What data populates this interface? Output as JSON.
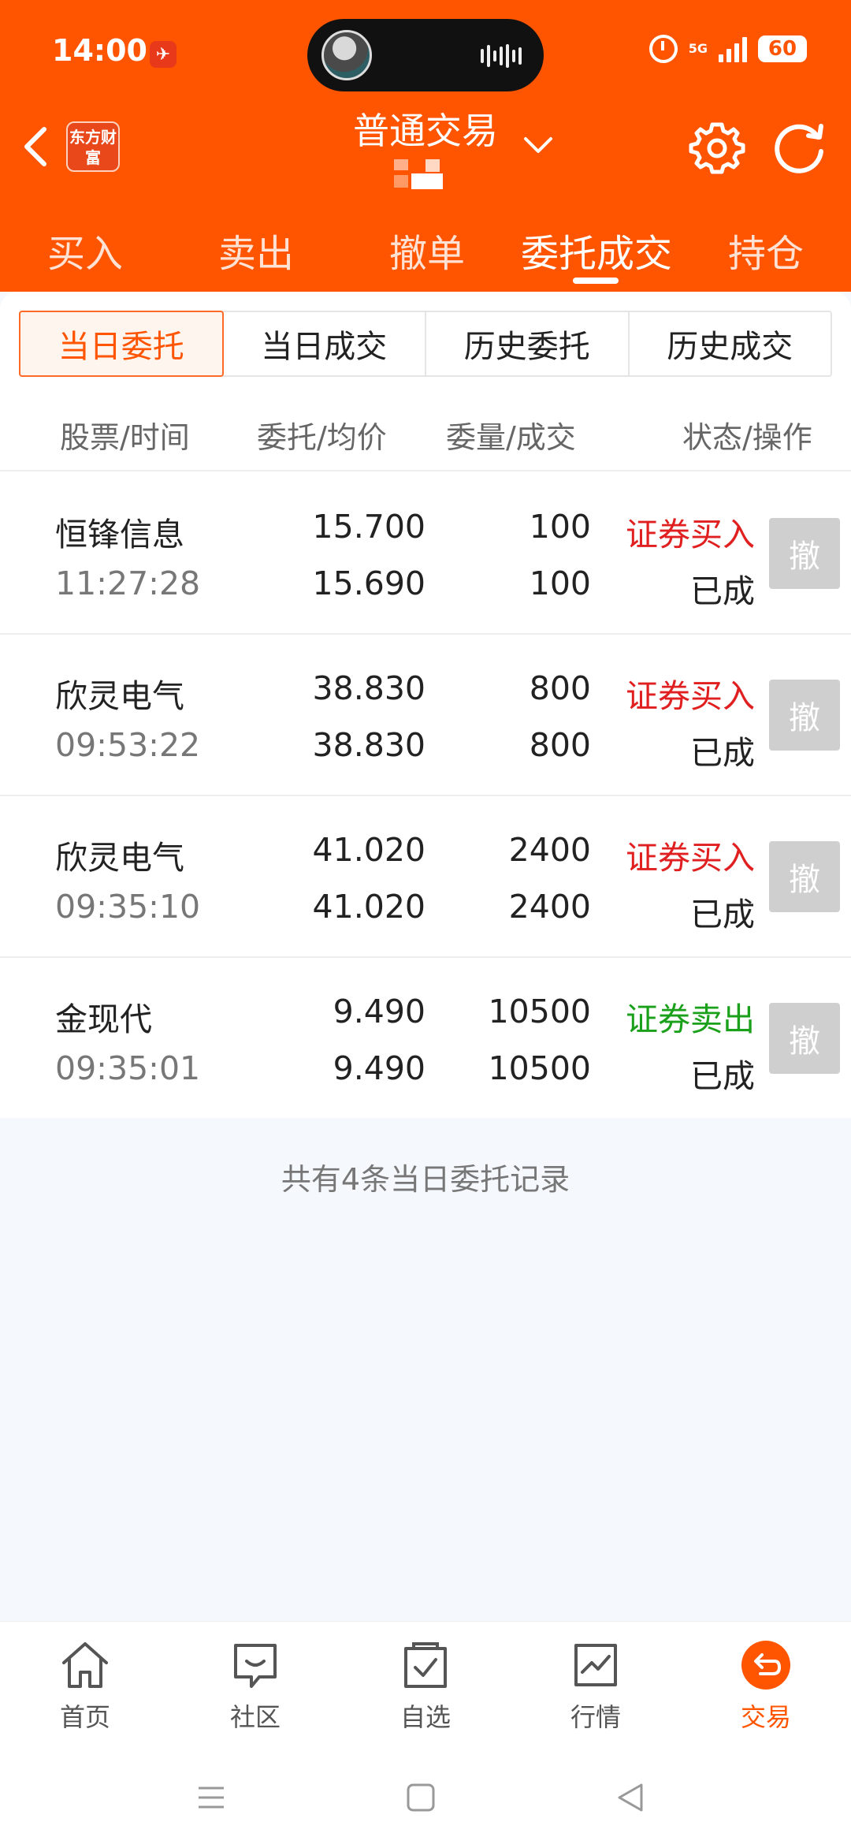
{
  "status_bar": {
    "time": "14:00",
    "network": "5G",
    "battery": "60"
  },
  "header": {
    "title": "普通交易",
    "brand_logo": "东方财富"
  },
  "main_tabs": [
    {
      "label": "买入",
      "active": false
    },
    {
      "label": "卖出",
      "active": false
    },
    {
      "label": "撤单",
      "active": false
    },
    {
      "label": "委托成交",
      "active": true
    },
    {
      "label": "持仓",
      "active": false
    }
  ],
  "sub_tabs": [
    {
      "label": "当日委托",
      "active": true
    },
    {
      "label": "当日成交",
      "active": false
    },
    {
      "label": "历史委托",
      "active": false
    },
    {
      "label": "历史成交",
      "active": false
    }
  ],
  "columns": [
    "股票/时间",
    "委托/均价",
    "委量/成交",
    "状态/操作"
  ],
  "orders": [
    {
      "name": "恒锋信息",
      "time": "11:27:28",
      "price": "15.700",
      "avg_price": "15.690",
      "qty": "100",
      "filled": "100",
      "direction": "证券买入",
      "direction_color": "#e02020",
      "status": "已成",
      "cancel_label": "撤"
    },
    {
      "name": "欣灵电气",
      "time": "09:53:22",
      "price": "38.830",
      "avg_price": "38.830",
      "qty": "800",
      "filled": "800",
      "direction": "证券买入",
      "direction_color": "#e02020",
      "status": "已成",
      "cancel_label": "撤"
    },
    {
      "name": "欣灵电气",
      "time": "09:35:10",
      "price": "41.020",
      "avg_price": "41.020",
      "qty": "2400",
      "filled": "2400",
      "direction": "证券买入",
      "direction_color": "#e02020",
      "status": "已成",
      "cancel_label": "撤"
    },
    {
      "name": "金现代",
      "time": "09:35:01",
      "price": "9.490",
      "avg_price": "9.490",
      "qty": "10500",
      "filled": "10500",
      "direction": "证券卖出",
      "direction_color": "#1aa01a",
      "status": "已成",
      "cancel_label": "撤"
    }
  ],
  "summary": "共有4条当日委托记录",
  "bottom_nav": [
    {
      "label": "首页",
      "icon": "home-icon",
      "active": false
    },
    {
      "label": "社区",
      "icon": "chat-bubble-icon",
      "active": false
    },
    {
      "label": "自选",
      "icon": "watchlist-icon",
      "active": false
    },
    {
      "label": "行情",
      "icon": "market-chart-icon",
      "active": false
    },
    {
      "label": "交易",
      "icon": "trade-icon",
      "active": true
    }
  ],
  "colors": {
    "brand": "#ff5500",
    "buy": "#e02020",
    "sell": "#1aa01a",
    "background": "#f5f8fd"
  }
}
